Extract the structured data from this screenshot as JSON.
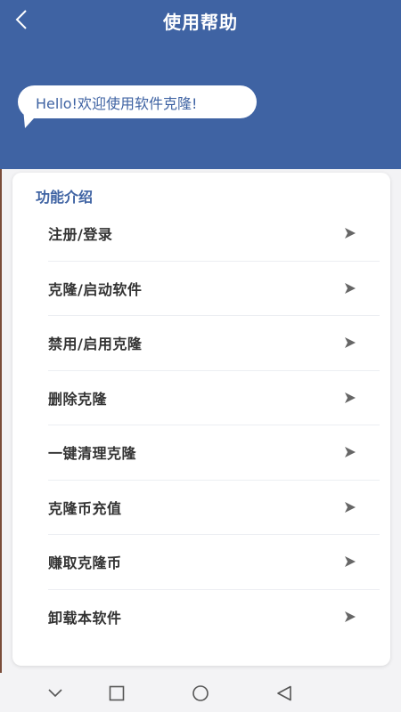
{
  "header": {
    "title": "使用帮助",
    "greeting": "Hello!欢迎使用软件克隆!",
    "background_color": "#3f63a3"
  },
  "card": {
    "section_title": "功能介绍",
    "items": [
      {
        "label": "注册/登录"
      },
      {
        "label": "克隆/启动软件"
      },
      {
        "label": "禁用/启用克隆"
      },
      {
        "label": "删除克隆"
      },
      {
        "label": "一键清理克隆"
      },
      {
        "label": "克隆币充值"
      },
      {
        "label": "赚取克隆币"
      },
      {
        "label": "卸载本软件"
      }
    ]
  },
  "icons": {
    "back": "chevron-left-icon",
    "item_arrow": "arrow-right-icon",
    "nav_down": "chevron-down-icon",
    "nav_recents": "square-icon",
    "nav_home": "circle-icon",
    "nav_back": "triangle-back-icon"
  }
}
